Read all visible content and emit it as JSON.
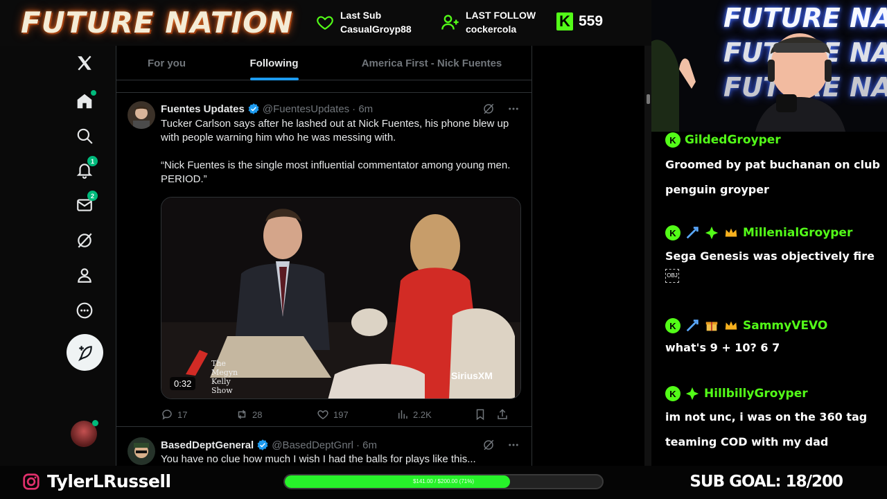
{
  "overlay": {
    "logo_left": "FUTURE NATION",
    "last_sub_label": "Last Sub",
    "last_sub_name": "CasualGroyp88",
    "last_follow_label": "LAST FOLLOW",
    "last_follow_name": "cockercola",
    "kick_letter": "K",
    "viewer_count": "559",
    "accent_color": "#53fc18"
  },
  "twitter": {
    "brand_icon": "x-logo-icon",
    "nav": [
      {
        "name": "home",
        "icon": "home-icon"
      },
      {
        "name": "explore",
        "icon": "search-icon"
      },
      {
        "name": "notifications",
        "icon": "bell-icon",
        "badge": "1"
      },
      {
        "name": "messages",
        "icon": "mail-icon",
        "badge": "2"
      },
      {
        "name": "grok",
        "icon": "grok-icon"
      },
      {
        "name": "profile",
        "icon": "person-icon"
      },
      {
        "name": "more",
        "icon": "more-circle-icon"
      }
    ],
    "tabs": [
      "For you",
      "Following",
      "America First - Nick Fuentes"
    ],
    "active_tab": "Following",
    "tweets": [
      {
        "name": "Fuentes Updates",
        "handle": "@FuentesUpdates",
        "time": "· 6m",
        "text_1": "Tucker Carlson says after he lashed out at Nick Fuentes, his phone blew up with people warning him who he was messing with.",
        "text_2": "“Nick Fuentes is the single most influential commentator among young men. PERIOD.”",
        "video_duration": "0:32",
        "watermark_show": "The Megyn Kelly Show",
        "watermark_network": "SiriusXM",
        "replies": "17",
        "reposts": "28",
        "likes": "197",
        "views": "2.2K"
      },
      {
        "name": "BasedDeptGeneral",
        "handle": "@BasedDeptGnrl",
        "time": "· 6m",
        "text_1": "You have no clue how much I wish I had the balls for plays like this..."
      }
    ]
  },
  "webcam": {
    "neon_lines": [
      "FUTURE NATION",
      "FUTURE NATION",
      "FUTURE NATION"
    ]
  },
  "chat": [
    {
      "user": "GildedGroyper",
      "badges": [
        "kick-badge-icon"
      ],
      "text": "Groomed by pat buchanan on club penguin groyper"
    },
    {
      "user": "MillenialGroyper",
      "badges": [
        "kick-badge-icon",
        "sword-badge-icon",
        "gem-badge-icon",
        "crown-badge-icon"
      ],
      "text": "Sega Genesis was objectively fire",
      "emote": "OBJ"
    },
    {
      "user": "SammyVEVO",
      "badges": [
        "kick-badge-icon",
        "sword-badge-icon",
        "gift-badge-icon",
        "crown-badge-icon"
      ],
      "text": "what's 9 + 10? 6 7"
    },
    {
      "user": "HillbillyGroyper",
      "badges": [
        "kick-badge-icon",
        "gem-badge-icon"
      ],
      "text": "im not unc, i was on the 360 tag teaming COD with my dad"
    }
  ],
  "bottombar": {
    "social_icon": "instagram-icon",
    "handle": "TylerLRussell",
    "progress_text": "$141.00 / $200.00 (71%)",
    "progress_fraction": 0.71,
    "sub_goal": "SUB GOAL: 18/200"
  }
}
